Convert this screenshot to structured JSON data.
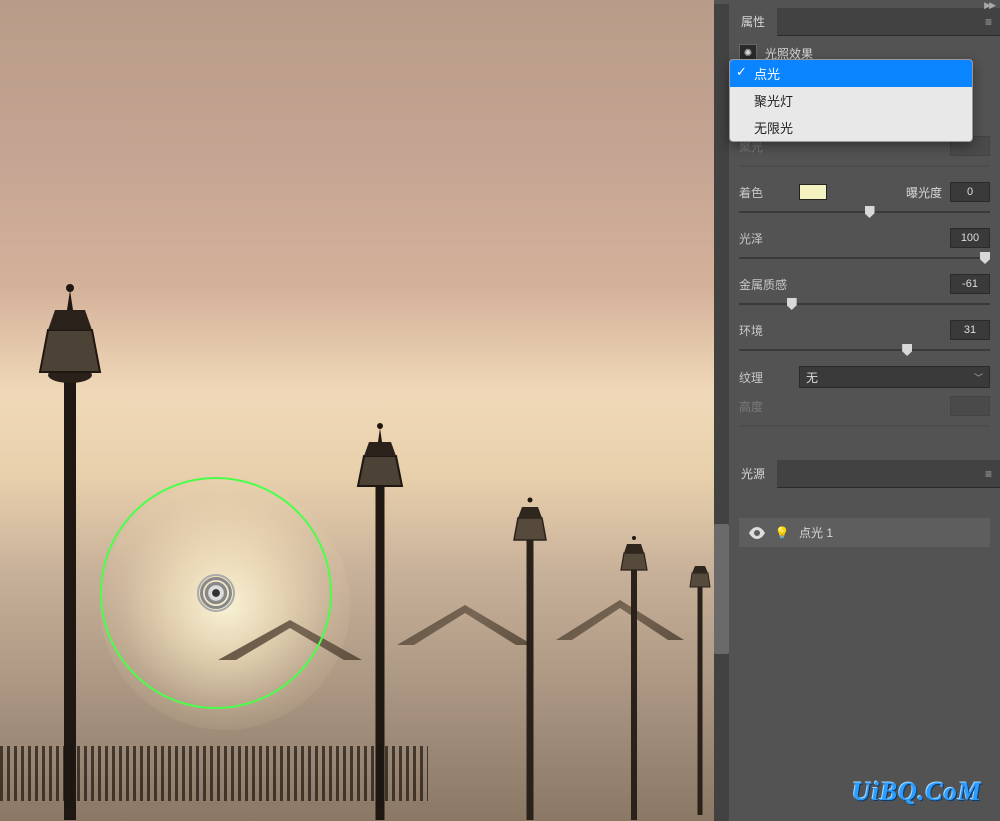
{
  "panels": {
    "properties": {
      "tab_label": "属性",
      "effect_name": "光照效果"
    },
    "lights": {
      "tab_label": "光源"
    }
  },
  "light_type_dropdown": {
    "selected": "点光",
    "options": [
      "点光",
      "聚光灯",
      "无限光"
    ]
  },
  "properties": {
    "spotlight": {
      "label": "聚光"
    },
    "colorize": {
      "label": "着色",
      "swatch_color": "#f5f2c1"
    },
    "exposure": {
      "label": "曝光度",
      "value": "0",
      "slider_pct": 50
    },
    "gloss": {
      "label": "光泽",
      "value": "100",
      "slider_pct": 100
    },
    "metallic": {
      "label": "金属质感",
      "value": "-61",
      "slider_pct": 19
    },
    "ambience": {
      "label": "环境",
      "value": "31",
      "slider_pct": 65
    },
    "texture": {
      "label": "纹理",
      "value": "无"
    },
    "height": {
      "label": "高度"
    }
  },
  "lights_list": [
    {
      "visible": true,
      "name": "点光 1"
    }
  ],
  "watermark": "UiBQ.CoM"
}
